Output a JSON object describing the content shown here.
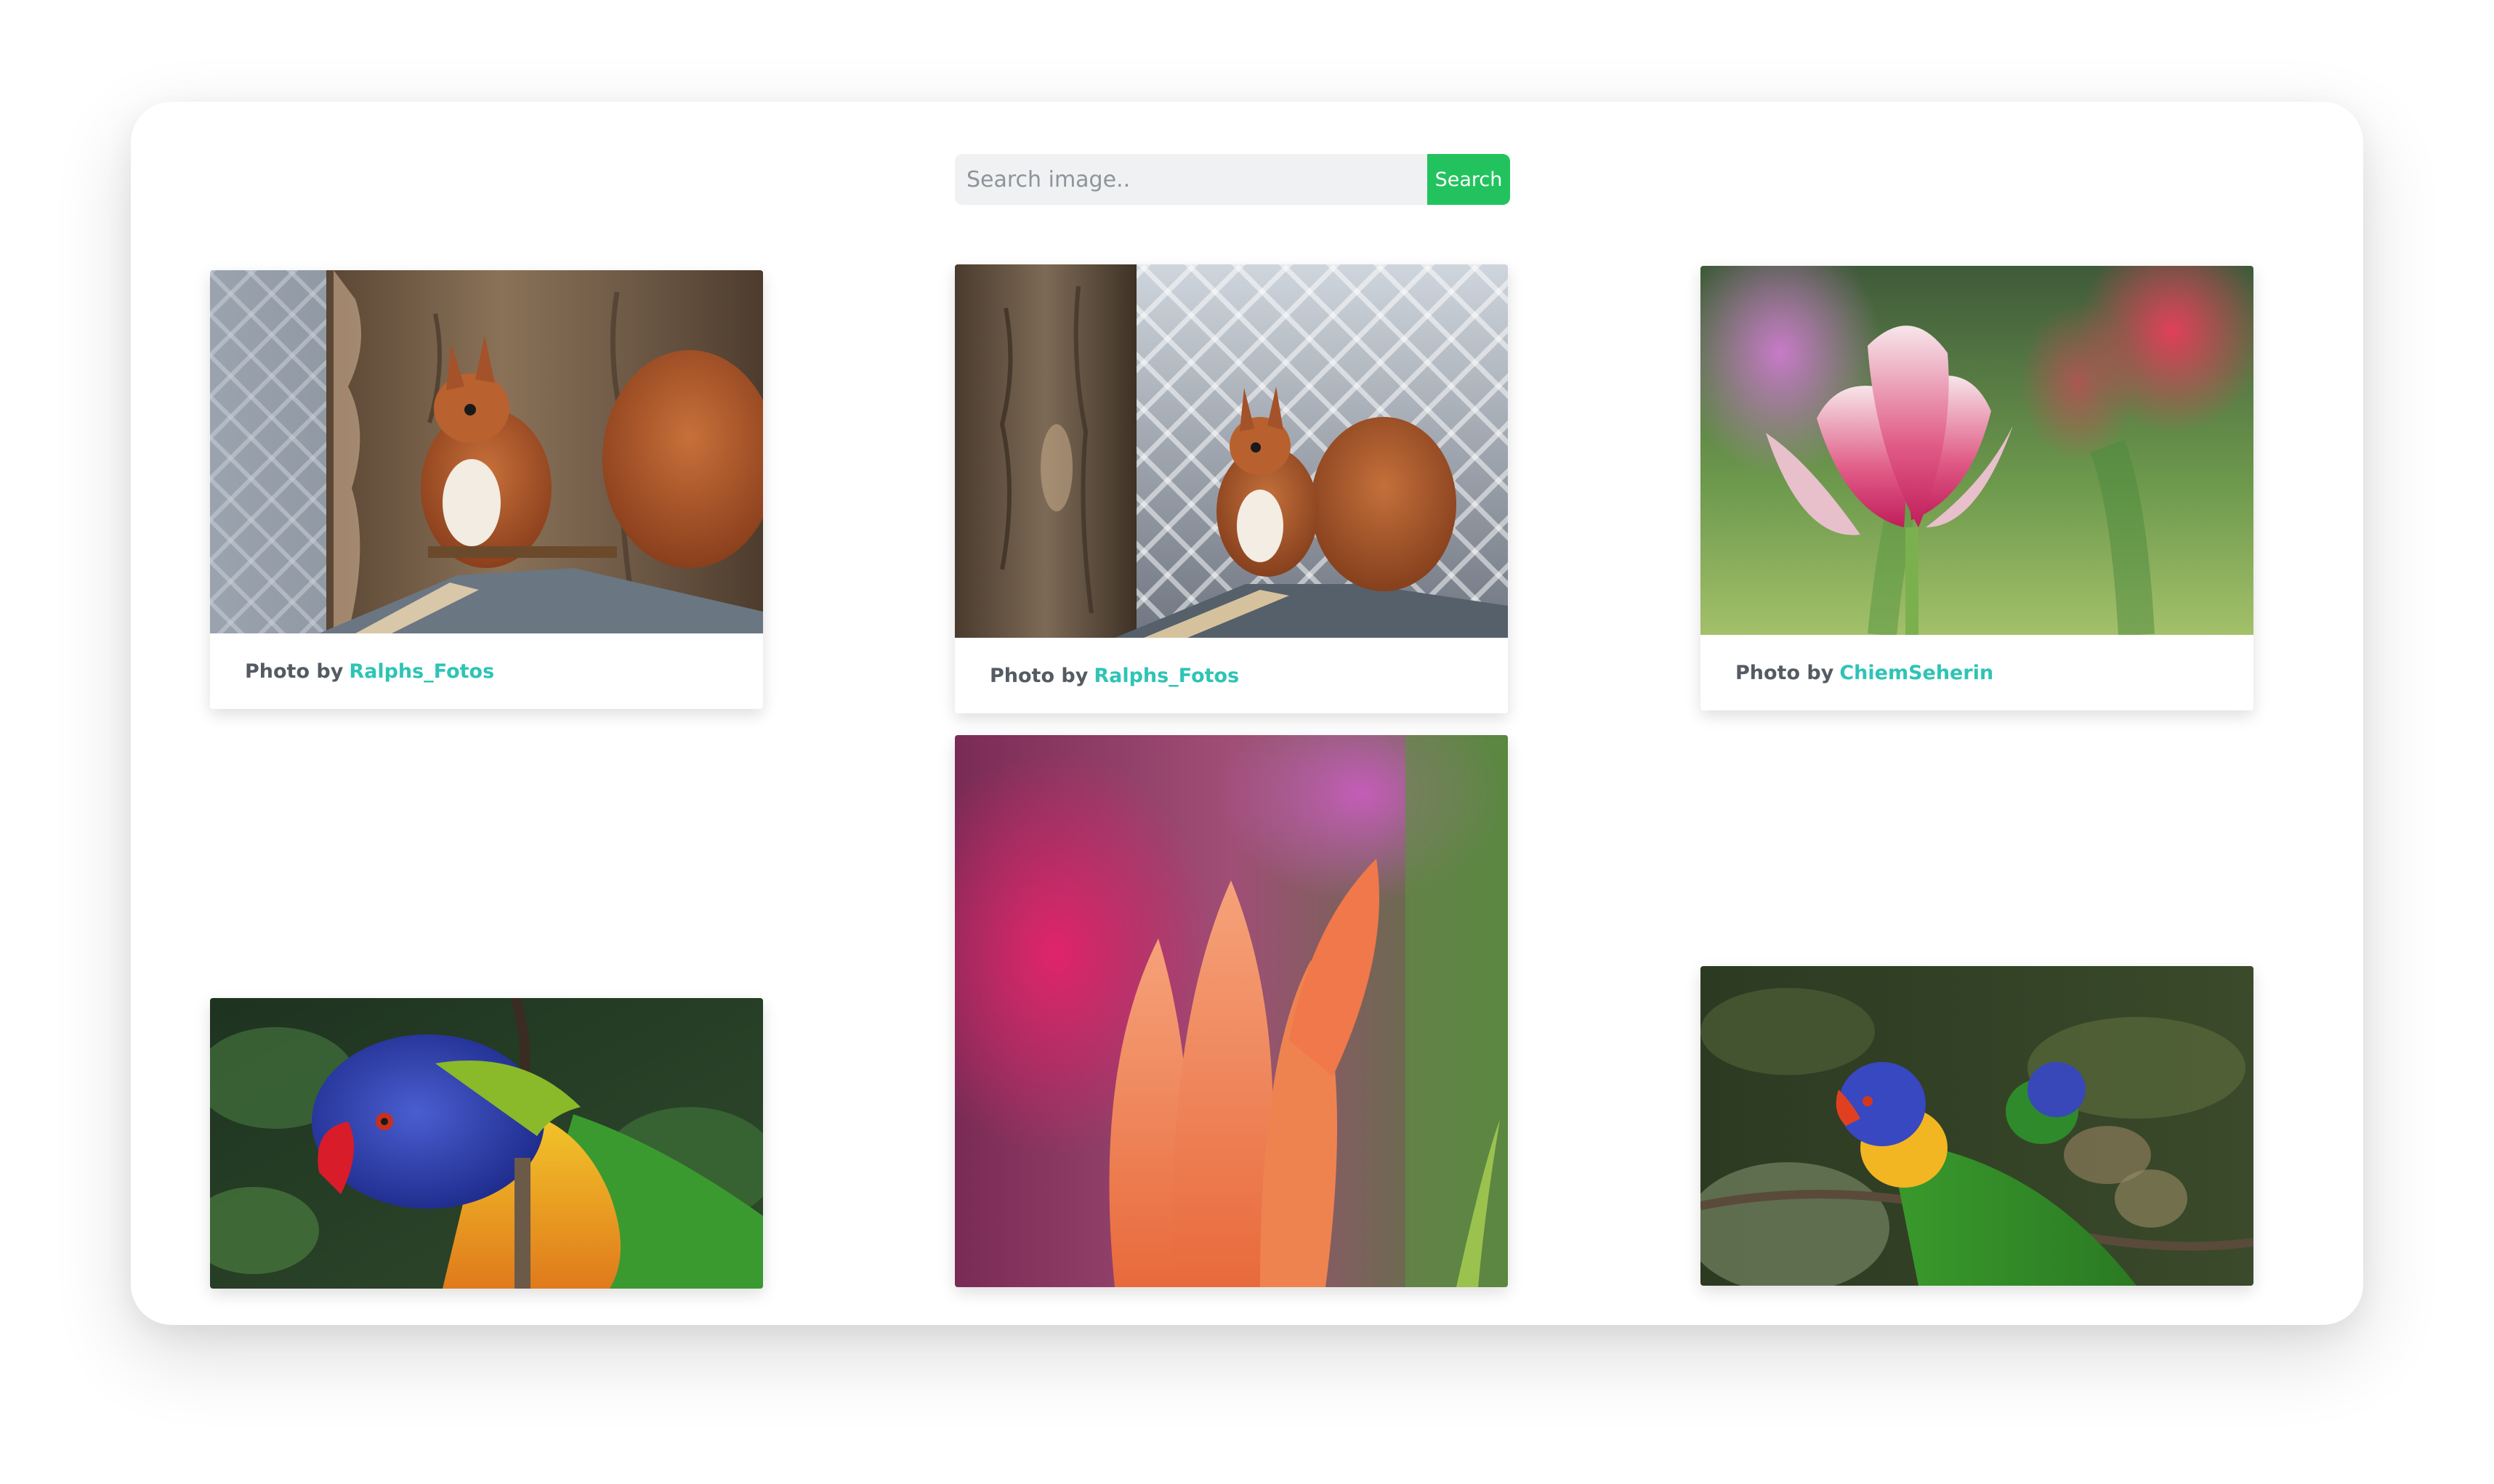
{
  "search": {
    "placeholder": "Search image..",
    "button_label": "Search"
  },
  "gallery": {
    "cards": [
      {
        "subject": "red squirrel on tree stump",
        "caption_prefix": "Photo by",
        "author": "Ralphs_Fotos"
      },
      {
        "subject": "red squirrel beside tree trunk",
        "caption_prefix": "Photo by",
        "author": "Ralphs_Fotos"
      },
      {
        "subject": "pink and white tulip",
        "caption_prefix": "Photo by",
        "author": "ChiemSeherin"
      },
      {
        "subject": "orange tulip bud"
      },
      {
        "subject": "rainbow lorikeet close-up"
      },
      {
        "subject": "rainbow lorikeets on branch"
      }
    ]
  },
  "colors": {
    "accent": "#22c35e",
    "author_link": "#2ec4b6"
  }
}
